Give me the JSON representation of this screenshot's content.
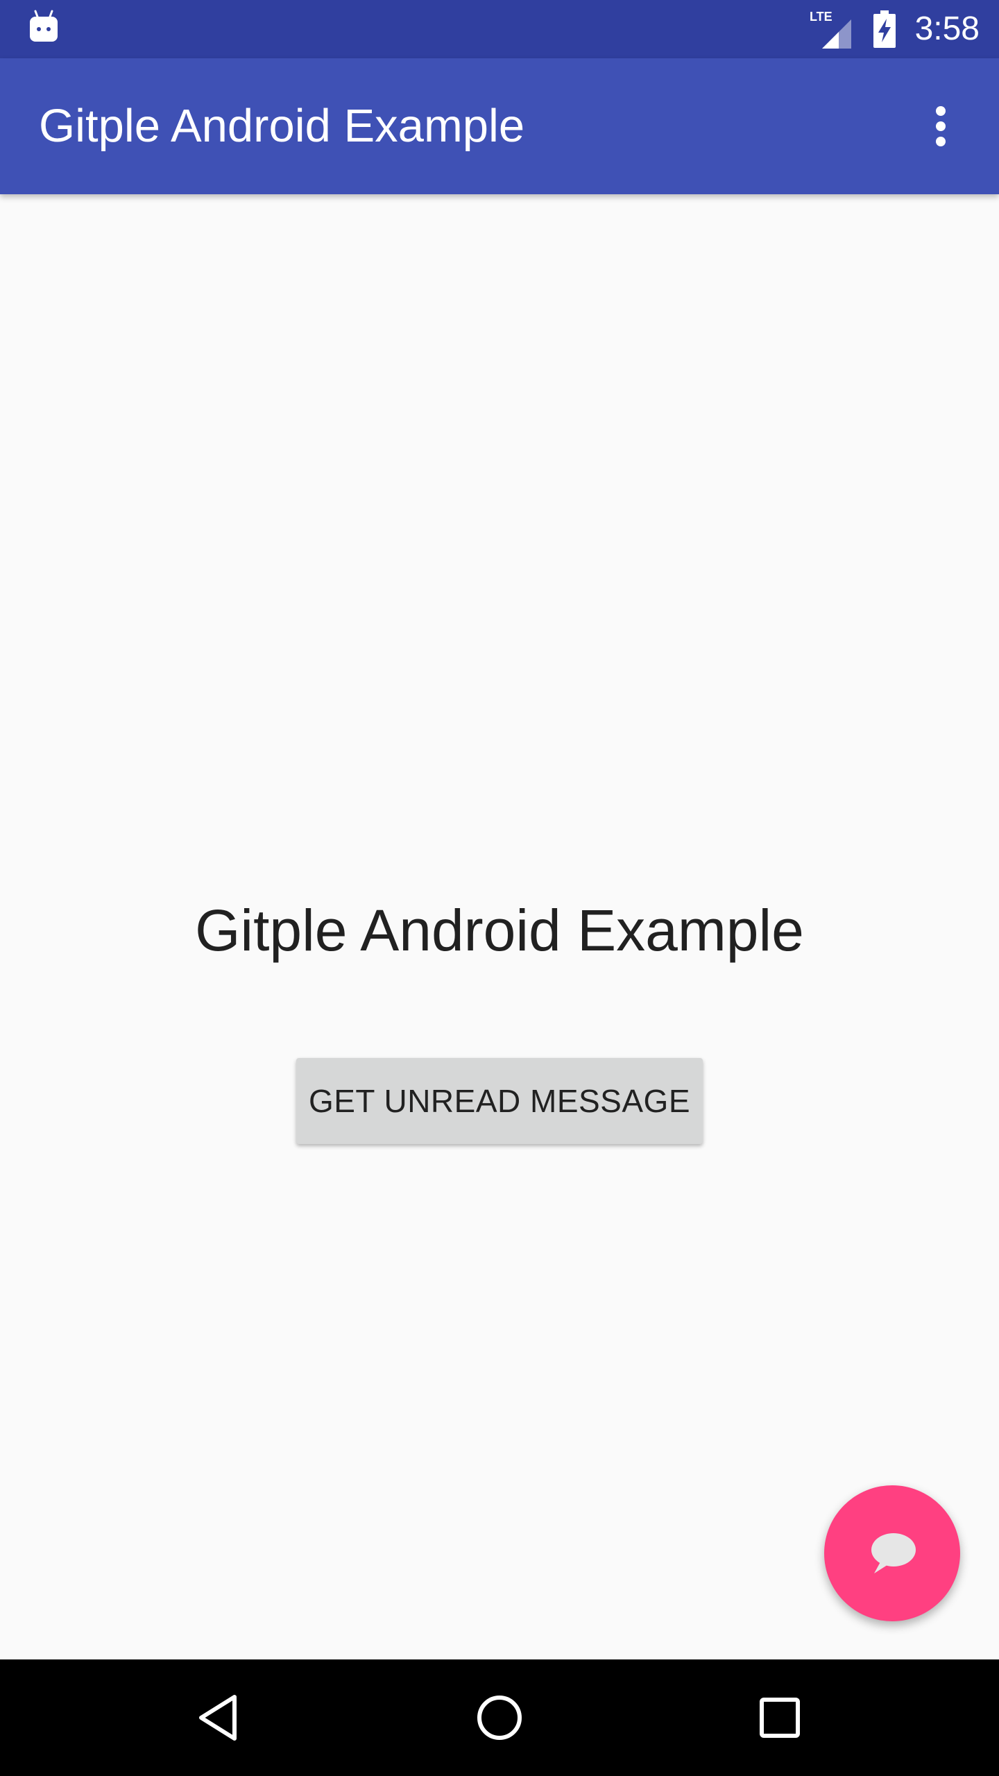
{
  "status_bar": {
    "notification_icon": "android-icon",
    "network_label": "LTE",
    "signal_icon": "signal-icon",
    "battery_icon": "battery-charging-icon",
    "time": "3:58"
  },
  "app_bar": {
    "title": "Gitple Android Example",
    "overflow_icon": "more-vert-icon"
  },
  "main": {
    "heading": "Gitple Android Example",
    "unread_button_label": "GET UNREAD MESSAGE",
    "fab_icon": "chat-bubble-icon"
  },
  "nav_bar": {
    "back_icon": "back-triangle-icon",
    "home_icon": "home-circle-icon",
    "recents_icon": "recents-square-icon"
  },
  "colors": {
    "status_bar": "#303f9f",
    "app_bar": "#3f51b5",
    "accent": "#ff4081",
    "background": "#fafafa"
  }
}
